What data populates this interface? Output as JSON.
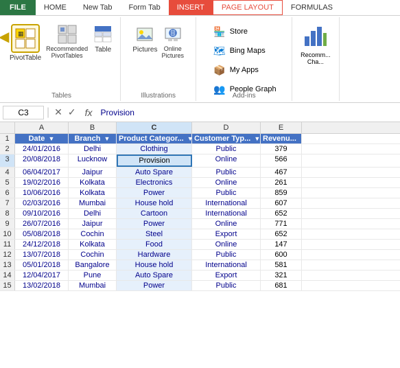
{
  "tabs": {
    "file": "FILE",
    "home": "HOME",
    "new_tab": "New Tab",
    "form_tab": "Form Tab",
    "insert": "INSERT",
    "page_layout": "PAGE LAYOUT",
    "formulas": "FORMULAS"
  },
  "ribbon": {
    "pivot_table": "PivotTable",
    "recommended_pivot": "Recommended\nPivotTables",
    "table": "Table",
    "pictures": "Pictures",
    "online_pictures": "Online\nPictures",
    "group_tables": "Tables",
    "group_illustrations": "Illustrations",
    "group_addins": "Add-ins",
    "store": "Store",
    "bing_maps": "Bing Maps",
    "my_apps": "My Apps",
    "people_graph": "People Graph",
    "recommend_charts": "Recomm...\nCha..."
  },
  "formula_bar": {
    "cell_ref": "C3",
    "formula_text": "Provision"
  },
  "headers": [
    "Date",
    "Branch",
    "Product Category",
    "Customer Type",
    "Revenue"
  ],
  "col_letters": [
    "A",
    "B",
    "C",
    "D",
    "E"
  ],
  "rows": [
    {
      "num": 2,
      "date": "24/01/2016",
      "branch": "Delhi",
      "product": "Clothing",
      "customer": "Public",
      "revenue": "379"
    },
    {
      "num": 3,
      "date": "20/08/2018",
      "branch": "Lucknow",
      "product": "Provision",
      "customer": "Online",
      "revenue": "566"
    },
    {
      "num": 4,
      "date": "06/04/2017",
      "branch": "Jaipur",
      "product": "Auto Spare",
      "customer": "Public",
      "revenue": "467"
    },
    {
      "num": 5,
      "date": "19/02/2016",
      "branch": "Kolkata",
      "product": "Electronics",
      "customer": "Online",
      "revenue": "261"
    },
    {
      "num": 6,
      "date": "10/06/2016",
      "branch": "Kolkata",
      "product": "Power",
      "customer": "Public",
      "revenue": "859"
    },
    {
      "num": 7,
      "date": "02/03/2016",
      "branch": "Mumbai",
      "product": "House hold",
      "customer": "International",
      "revenue": "607"
    },
    {
      "num": 8,
      "date": "09/10/2016",
      "branch": "Delhi",
      "product": "Cartoon",
      "customer": "International",
      "revenue": "652"
    },
    {
      "num": 9,
      "date": "26/07/2016",
      "branch": "Jaipur",
      "product": "Power",
      "customer": "Online",
      "revenue": "771"
    },
    {
      "num": 10,
      "date": "05/08/2018",
      "branch": "Cochin",
      "product": "Steel",
      "customer": "Export",
      "revenue": "652"
    },
    {
      "num": 11,
      "date": "24/12/2018",
      "branch": "Kolkata",
      "product": "Food",
      "customer": "Online",
      "revenue": "147"
    },
    {
      "num": 12,
      "date": "13/07/2018",
      "branch": "Cochin",
      "product": "Hardware",
      "customer": "Public",
      "revenue": "600"
    },
    {
      "num": 13,
      "date": "05/01/2018",
      "branch": "Bangalore",
      "product": "House hold",
      "customer": "International",
      "revenue": "581"
    },
    {
      "num": 14,
      "date": "12/04/2017",
      "branch": "Pune",
      "product": "Auto Spare",
      "customer": "Export",
      "revenue": "321"
    },
    {
      "num": 15,
      "date": "13/02/2018",
      "branch": "Mumbai",
      "product": "Power",
      "customer": "Public",
      "revenue": "681"
    }
  ]
}
